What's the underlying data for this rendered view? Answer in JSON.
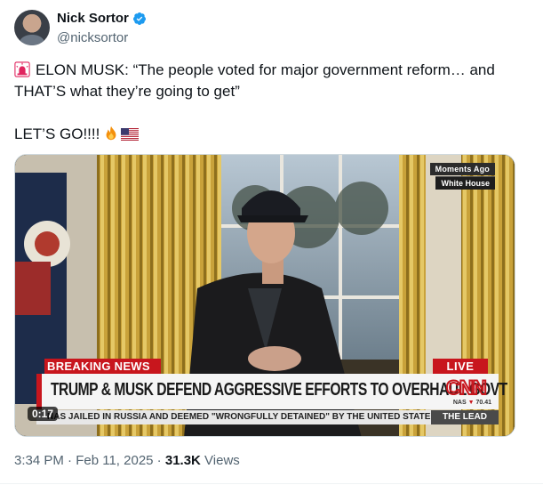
{
  "author": {
    "display_name": "Nick Sortor",
    "handle": "@nicksortor",
    "avatar_icon": "user-avatar",
    "verified_icon": "verified-badge-icon",
    "verified_color": "#1d9bf0"
  },
  "tweet": {
    "line1": "ELON MUSK: “The people voted for major government reform… and",
    "line2": "THAT’S what they’re going to get”",
    "line3": "LET’S GO!!!!",
    "emojis": [
      "rotating-light-icon",
      "fire-icon",
      "us-flag-icon"
    ]
  },
  "video": {
    "duration": "0:17",
    "broadcast": {
      "moments_ago": "Moments Ago",
      "location": "White House",
      "breaking": "BREAKING NEWS",
      "live": "LIVE",
      "headline": "TRUMP & MUSK DEFEND AGGRESSIVE EFFORTS TO OVERHAUL GOVT",
      "network": "CNN",
      "ticker_symbol": "NAS",
      "ticker_value": "70.41",
      "crawl": "NAS JAILED IN RUSSIA AND DEEMED \"WRONGFULLY DETAINED\" BY THE UNITED STATE",
      "crawl_tag": "THE LEAD",
      "brand_red": "#c8161d"
    }
  },
  "meta": {
    "time": "3:34 PM",
    "separator": " · ",
    "date": "Feb 11, 2025",
    "views_count": "31.3K",
    "views_label": " Views"
  }
}
